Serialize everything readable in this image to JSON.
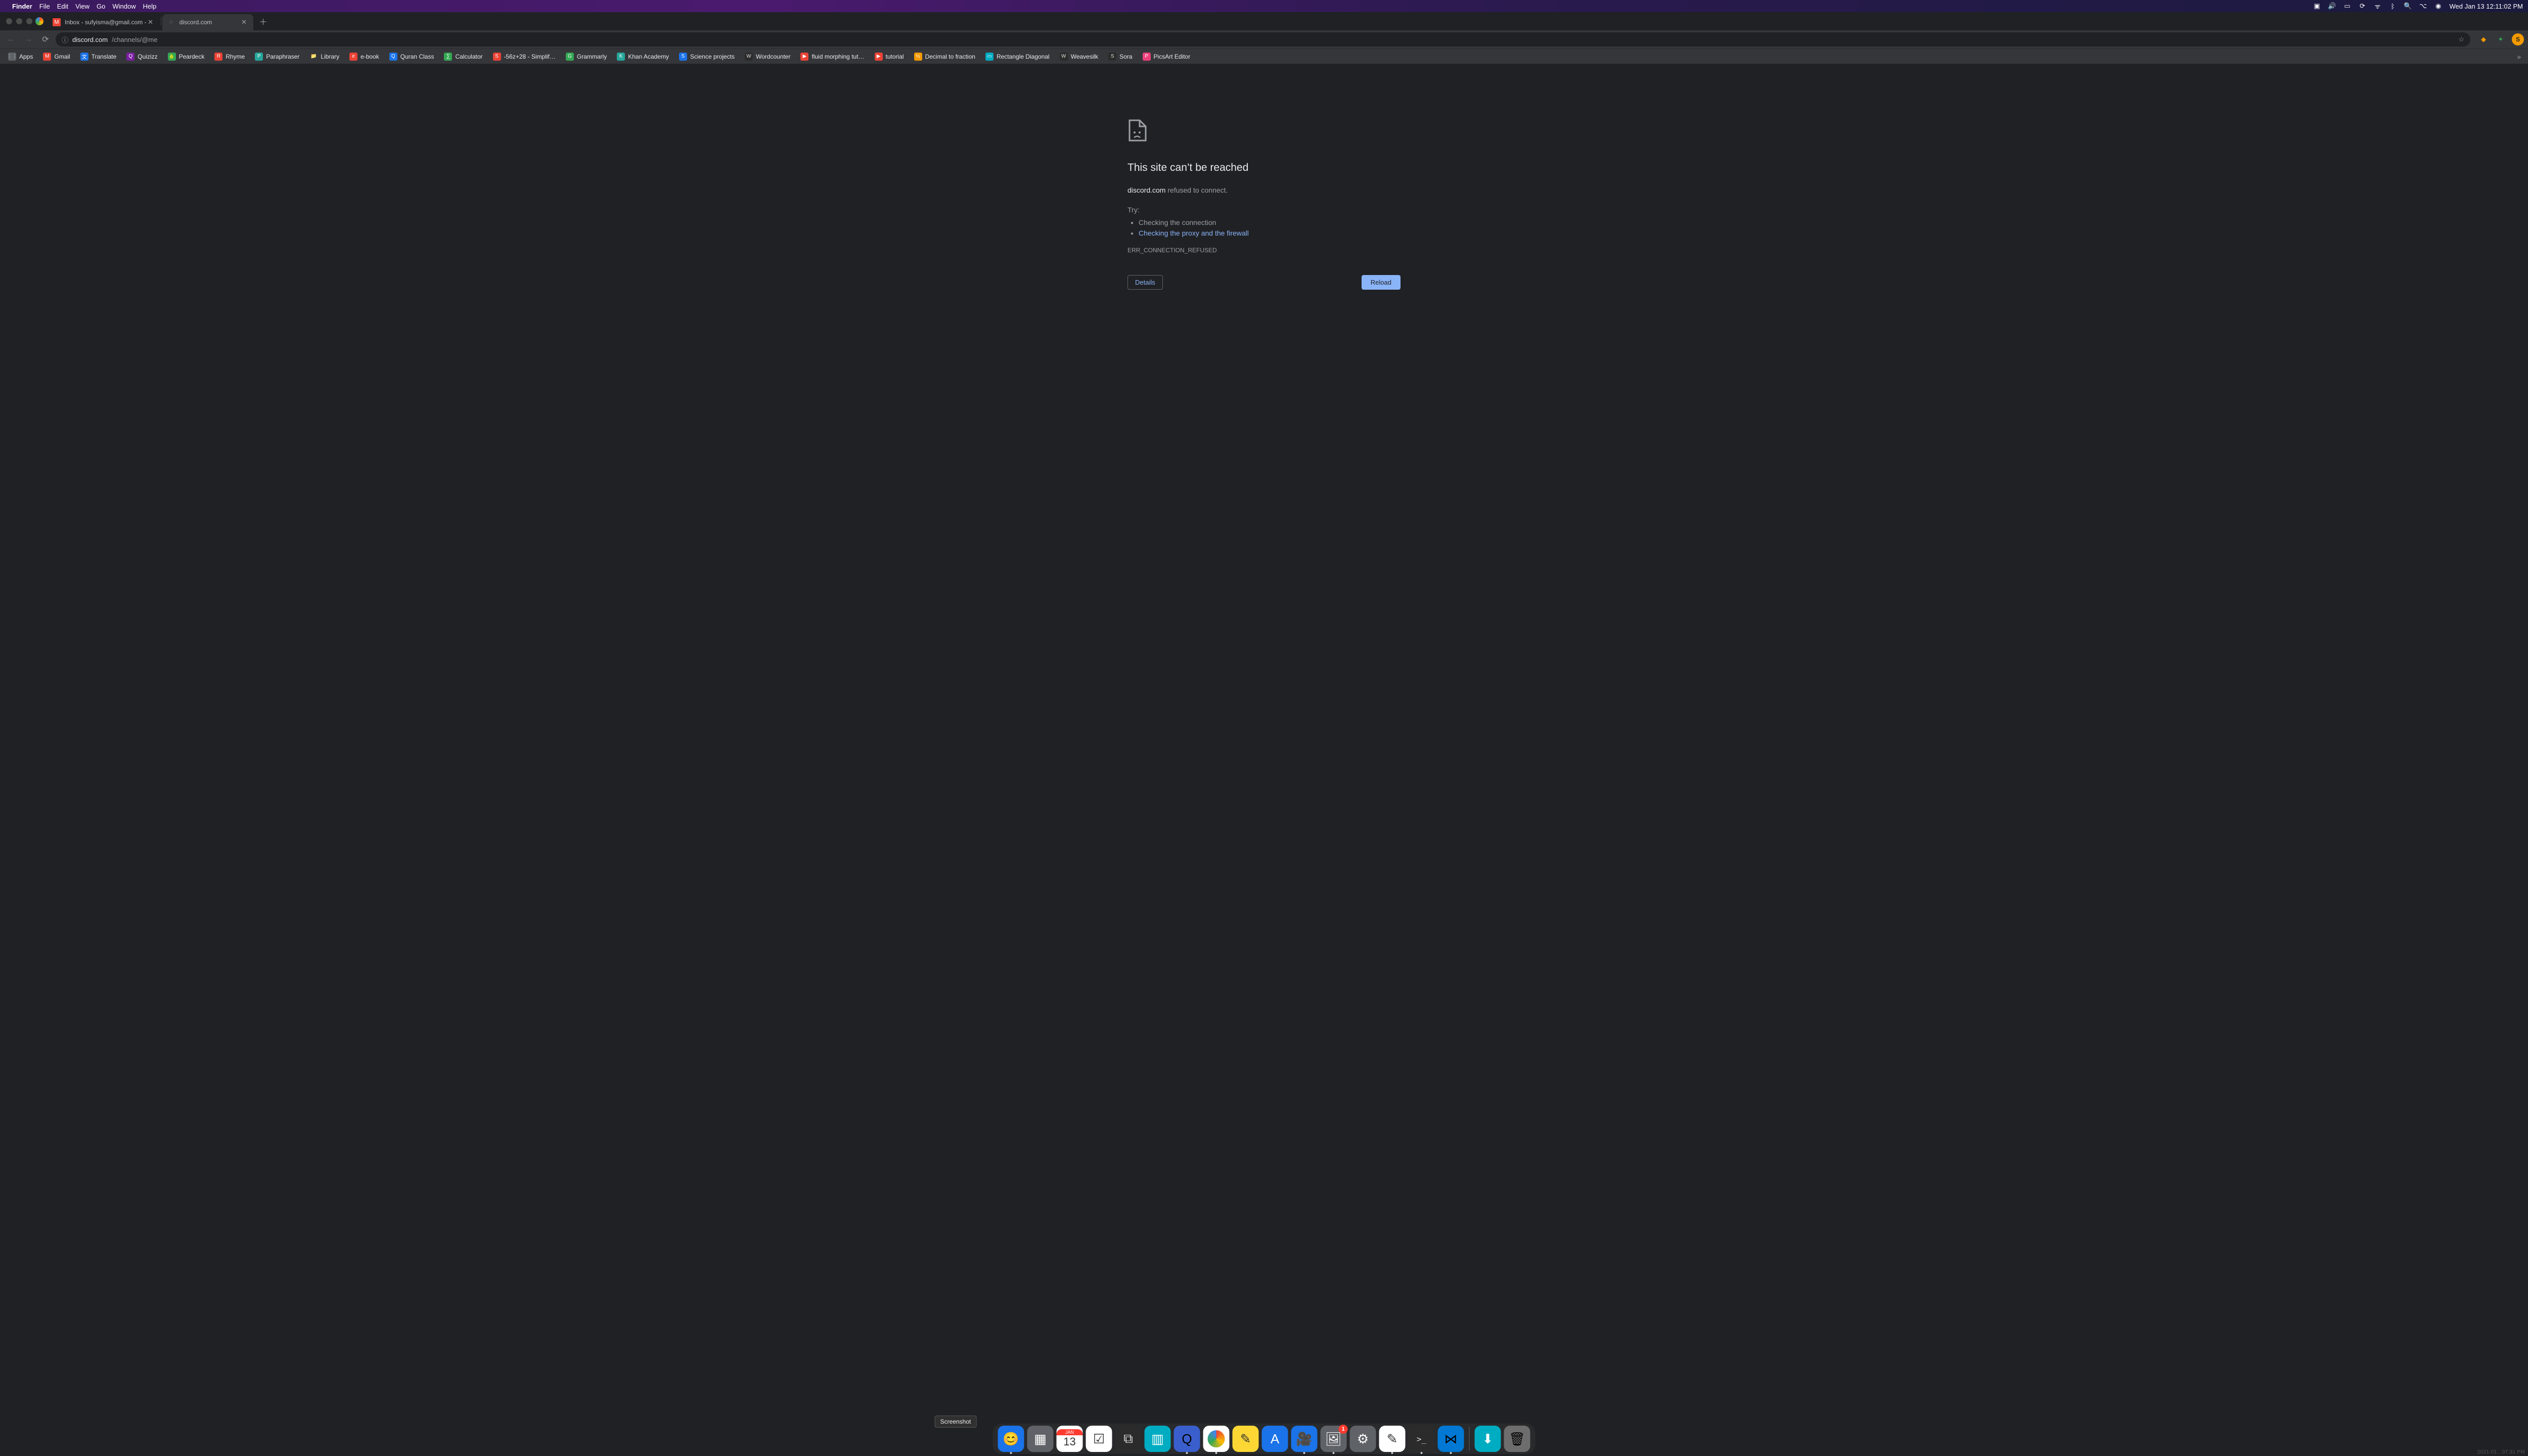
{
  "menubar": {
    "app_name": "Finder",
    "menus": [
      "File",
      "Edit",
      "View",
      "Go",
      "Window",
      "Help"
    ],
    "clock": "Wed Jan 13  12:11:02 PM"
  },
  "tabs": [
    {
      "title": "Inbox - sufyisma@gmail.com -",
      "favicon_bg": "bg-red",
      "favicon_glyph": "M",
      "active": false
    },
    {
      "title": "discord.com",
      "favicon_bg": "",
      "favicon_glyph": "",
      "active": true
    }
  ],
  "omnibox": {
    "url_primary": "discord.com",
    "url_secondary": "/channels/@me"
  },
  "bookmarks": [
    {
      "label": "Apps",
      "bg": "bg-grey",
      "glyph": "⋮⋮"
    },
    {
      "label": "Gmail",
      "bg": "bg-red",
      "glyph": "M"
    },
    {
      "label": "Translate",
      "bg": "bg-blue",
      "glyph": "文"
    },
    {
      "label": "Quizizz",
      "bg": "bg-purple",
      "glyph": "Q"
    },
    {
      "label": "Peardeck",
      "bg": "bg-green",
      "glyph": "🍐"
    },
    {
      "label": "Rhyme",
      "bg": "bg-red",
      "glyph": "R"
    },
    {
      "label": "Paraphraser",
      "bg": "bg-teal",
      "glyph": "P"
    },
    {
      "label": "Library",
      "bg": "",
      "glyph": "📁"
    },
    {
      "label": "e-book",
      "bg": "bg-red",
      "glyph": "e"
    },
    {
      "label": "Quran Class",
      "bg": "bg-blue",
      "glyph": "Q"
    },
    {
      "label": "Calculator",
      "bg": "bg-green",
      "glyph": "∑"
    },
    {
      "label": "-56z+28 - Simplif…",
      "bg": "bg-red",
      "glyph": "S"
    },
    {
      "label": "Grammarly",
      "bg": "bg-green",
      "glyph": "G"
    },
    {
      "label": "Khan Academy",
      "bg": "bg-teal",
      "glyph": "K"
    },
    {
      "label": "Science projects",
      "bg": "bg-blue",
      "glyph": "S"
    },
    {
      "label": "Wordcounter",
      "bg": "bg-dark",
      "glyph": "W"
    },
    {
      "label": "fluid morphing tut…",
      "bg": "bg-red",
      "glyph": "▶"
    },
    {
      "label": "tutorial",
      "bg": "bg-red",
      "glyph": "▶"
    },
    {
      "label": "Decimal to fraction",
      "bg": "bg-orange",
      "glyph": "½"
    },
    {
      "label": "Rectangle Diagonal",
      "bg": "bg-cyan",
      "glyph": "▭"
    },
    {
      "label": "Weavesilk",
      "bg": "bg-dark",
      "glyph": "W"
    },
    {
      "label": "Sora",
      "bg": "bg-dark",
      "glyph": "S"
    },
    {
      "label": "PicsArt Editor",
      "bg": "bg-pink",
      "glyph": "P"
    }
  ],
  "error": {
    "title": "This site can’t be reached",
    "domain": "discord.com",
    "refused": " refused to connect.",
    "try_label": "Try:",
    "suggestion_1": "Checking the connection",
    "suggestion_2": "Checking the proxy and the firewall",
    "code": "ERR_CONNECTION_REFUSED",
    "details_label": "Details",
    "reload_label": "Reload"
  },
  "dock_tooltip": "Screenshot",
  "watermark": "2021-01…07:31 PM",
  "dock": [
    {
      "name": "finder",
      "bg": "bg-blue",
      "glyph": "😊",
      "running": true
    },
    {
      "name": "launchpad",
      "bg": "bg-grey",
      "glyph": "▦",
      "running": false
    },
    {
      "name": "calendar",
      "bg": "bg-white",
      "glyph": "13",
      "running": false,
      "top_label": "JAN"
    },
    {
      "name": "reminders",
      "bg": "bg-white",
      "glyph": "☑",
      "running": false
    },
    {
      "name": "screenshot",
      "bg": "bg-dark",
      "glyph": "⧉",
      "running": false
    },
    {
      "name": "trello",
      "bg": "bg-cyan",
      "glyph": "▥",
      "running": false
    },
    {
      "name": "quicktime",
      "bg": "bg-blue",
      "glyph": "Q",
      "running": true
    },
    {
      "name": "chrome",
      "bg": "bg-white",
      "glyph": "◎",
      "running": true
    },
    {
      "name": "notes",
      "bg": "bg-yellow",
      "glyph": "✎",
      "running": false
    },
    {
      "name": "appstore",
      "bg": "bg-blue",
      "glyph": "A",
      "running": false
    },
    {
      "name": "zoom",
      "bg": "bg-blue",
      "glyph": "🎥",
      "running": true
    },
    {
      "name": "preview",
      "bg": "bg-grey",
      "glyph": "🖼",
      "running": true,
      "badge": "1"
    },
    {
      "name": "settings",
      "bg": "bg-grey",
      "glyph": "⚙",
      "running": false
    },
    {
      "name": "textedit",
      "bg": "bg-white",
      "glyph": "✎",
      "running": true
    },
    {
      "name": "terminal",
      "bg": "bg-dark",
      "glyph": ">_",
      "running": true
    },
    {
      "name": "vscode",
      "bg": "bg-blue",
      "glyph": "⋈",
      "running": true
    }
  ],
  "dock_right": [
    {
      "name": "downloads",
      "bg": "bg-cyan",
      "glyph": "⬇"
    },
    {
      "name": "trash",
      "bg": "bg-grey",
      "glyph": "🗑"
    }
  ],
  "avatar_letter": "S"
}
